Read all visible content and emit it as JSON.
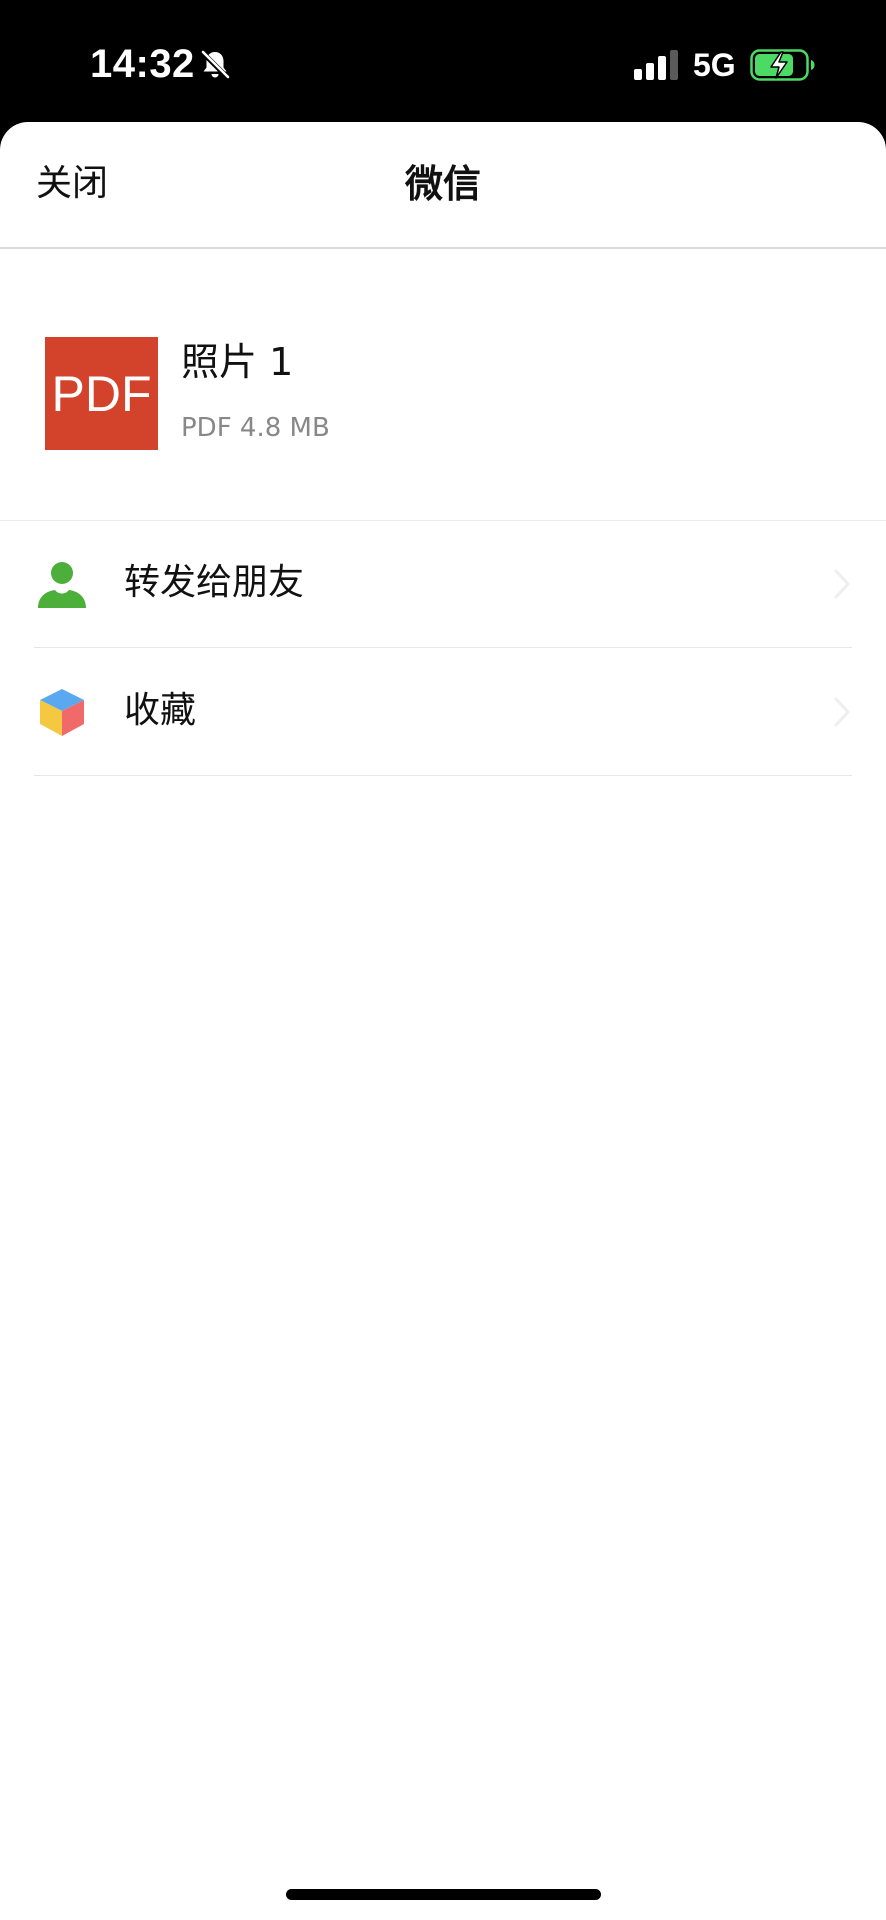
{
  "status_bar": {
    "time": "14:32",
    "network": "5G",
    "icons": [
      "bell-off-icon",
      "signal-icon",
      "battery-charging-icon"
    ],
    "battery_color": "#4cd964"
  },
  "nav": {
    "close_label": "关闭",
    "title": "微信"
  },
  "file": {
    "icon_text": "PDF",
    "icon_color": "#d3432b",
    "name": "照片 1",
    "meta": "PDF 4.8 MB"
  },
  "actions": [
    {
      "label": "转发给朋友",
      "icon": "person-icon",
      "icon_color": "#4caf3a"
    },
    {
      "label": "收藏",
      "icon": "cube-icon"
    }
  ]
}
